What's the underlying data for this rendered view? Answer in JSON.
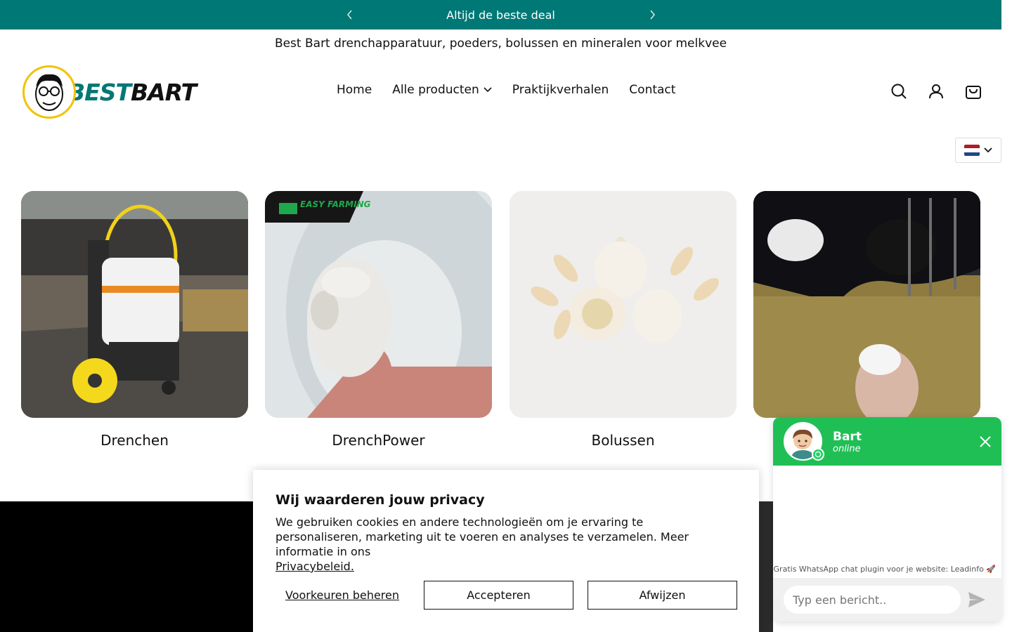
{
  "announcement": {
    "text": "Altijd de beste deal",
    "prev_icon": "chevron-left-icon",
    "next_icon": "chevron-right-icon"
  },
  "tagline": "Best Bart drenchapparatuur, poeders, bolussen en mineralen voor melkvee",
  "logo": {
    "word1": "BEST",
    "word2": "BART"
  },
  "nav": {
    "items": [
      {
        "label": "Home"
      },
      {
        "label": "Alle producten"
      },
      {
        "label": "Praktijkverhalen"
      },
      {
        "label": "Contact"
      }
    ]
  },
  "header_icons": [
    "search-icon",
    "account-icon",
    "cart-icon"
  ],
  "language": {
    "flag": "NL",
    "colors": [
      "#AE1C28",
      "#FFFFFF",
      "#21468B"
    ]
  },
  "categories": [
    {
      "title": "Drenchen"
    },
    {
      "title": "DrenchPower"
    },
    {
      "title": "Bolussen"
    },
    {
      "title": ""
    }
  ],
  "category_badge": "EASY FARMING",
  "cookie": {
    "title": "Wij waarderen jouw privacy",
    "body": "We gebruiken cookies en andere technologieën om je ervaring te personaliseren, marketing uit te voeren en analyses te verzamelen. Meer informatie in ons",
    "link": "Privacybeleid.",
    "manage": "Voorkeuren beheren",
    "accept": "Accepteren",
    "reject": "Afwijzen"
  },
  "whatsapp": {
    "name": "Bart",
    "status": "online",
    "credit": "Gratis WhatsApp chat plugin voor je website: Leadinfo 🚀",
    "placeholder": "Typ een bericht.."
  },
  "colors": {
    "brand": "#007876",
    "accent": "#F2C200",
    "whatsapp": "#20BF55"
  }
}
